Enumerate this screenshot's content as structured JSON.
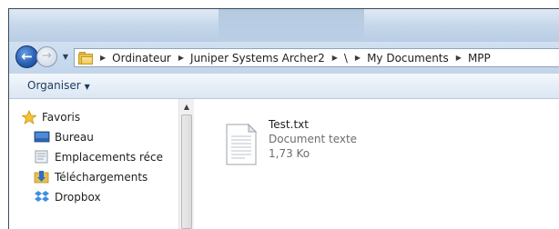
{
  "breadcrumb": {
    "items": [
      "Ordinateur",
      "Juniper Systems Archer2",
      "\\",
      "My Documents",
      "MPP"
    ]
  },
  "toolbar": {
    "organize_label": "Organiser"
  },
  "sidebar": {
    "items": [
      {
        "label": "Favoris",
        "icon": "star-icon"
      },
      {
        "label": "Bureau",
        "icon": "desktop-icon"
      },
      {
        "label": "Emplacements réce",
        "icon": "recent-places-icon"
      },
      {
        "label": "Téléchargements",
        "icon": "downloads-icon"
      },
      {
        "label": "Dropbox",
        "icon": "dropbox-icon"
      }
    ]
  },
  "file": {
    "name": "Test.txt",
    "type": "Document texte",
    "size": "1,73 Ko",
    "icon": "text-document-icon"
  },
  "colors": {
    "navbar": "#c1d5ec",
    "back_button": "#2a61b6",
    "folder": "#e8c155"
  }
}
